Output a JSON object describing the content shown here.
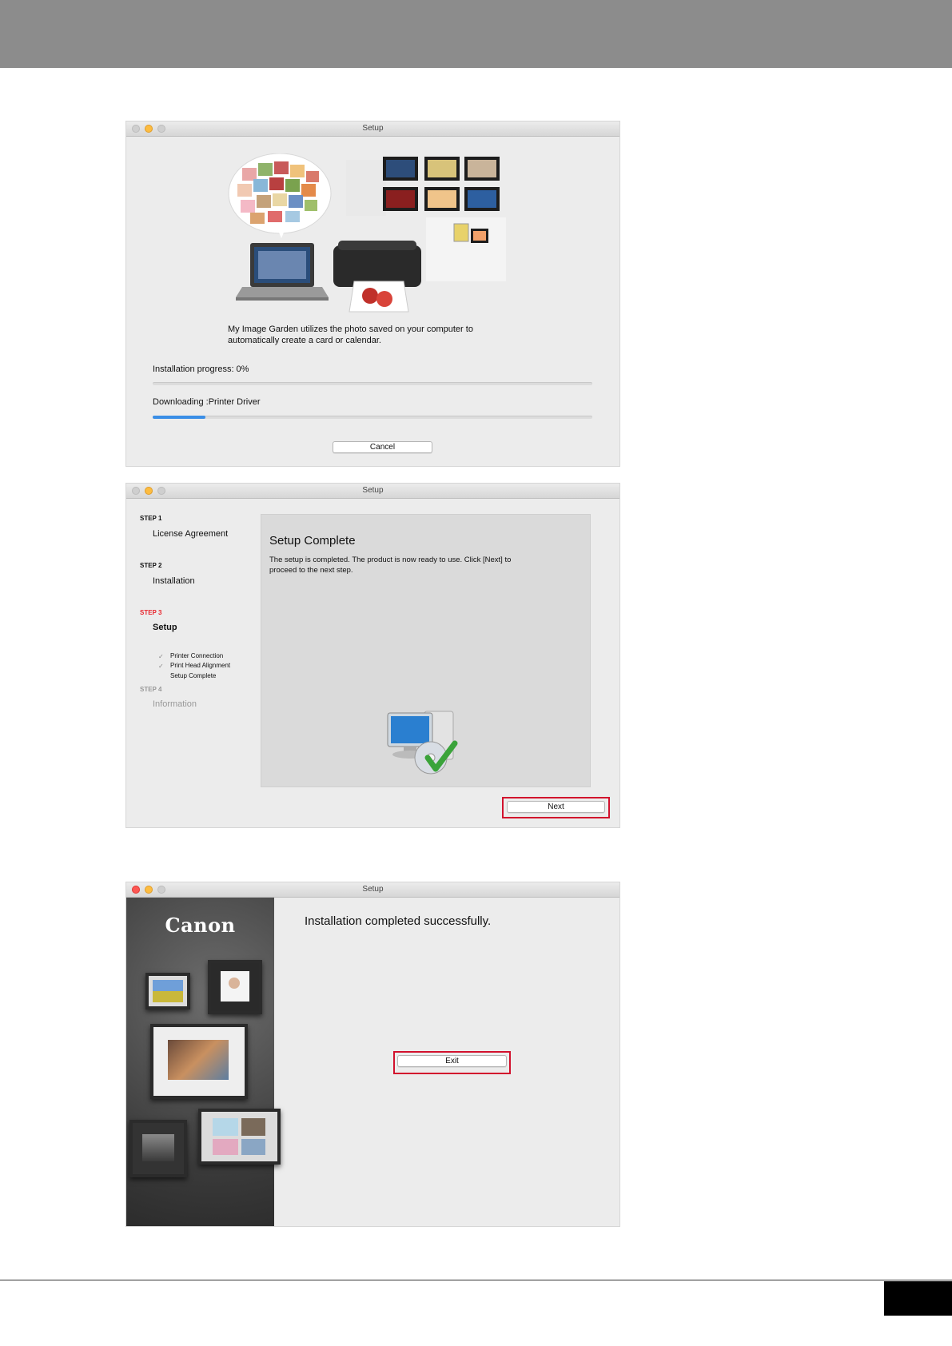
{
  "window1": {
    "title": "Setup",
    "caption_line1": "My Image Garden utilizes the photo saved on your computer to",
    "caption_line2": "automatically create a card or calendar.",
    "installation_progress_label": "Installation progress: 0%",
    "installation_progress_value": 0,
    "downloading_label": "Downloading :Printer Driver",
    "download_progress_value": 0.12,
    "cancel_label": "Cancel"
  },
  "window2": {
    "title": "Setup",
    "steps": [
      {
        "header": "STEP 1",
        "title": "License Agreement"
      },
      {
        "header": "STEP 2",
        "title": "Installation"
      },
      {
        "header": "STEP 3",
        "title": "Setup"
      },
      {
        "header": "STEP 4",
        "title": "Information"
      }
    ],
    "substeps": [
      "Printer Connection",
      "Print Head Alignment",
      "Setup Complete"
    ],
    "panel_title": "Setup Complete",
    "panel_text_line1": "The setup is completed. The product is now ready to use. Click [Next] to",
    "panel_text_line2": "proceed to the next step.",
    "next_label": "Next",
    "active_step_color": "#e8262e"
  },
  "window3": {
    "title": "Setup",
    "brand": "Canon",
    "message": "Installation completed successfully.",
    "exit_label": "Exit"
  }
}
